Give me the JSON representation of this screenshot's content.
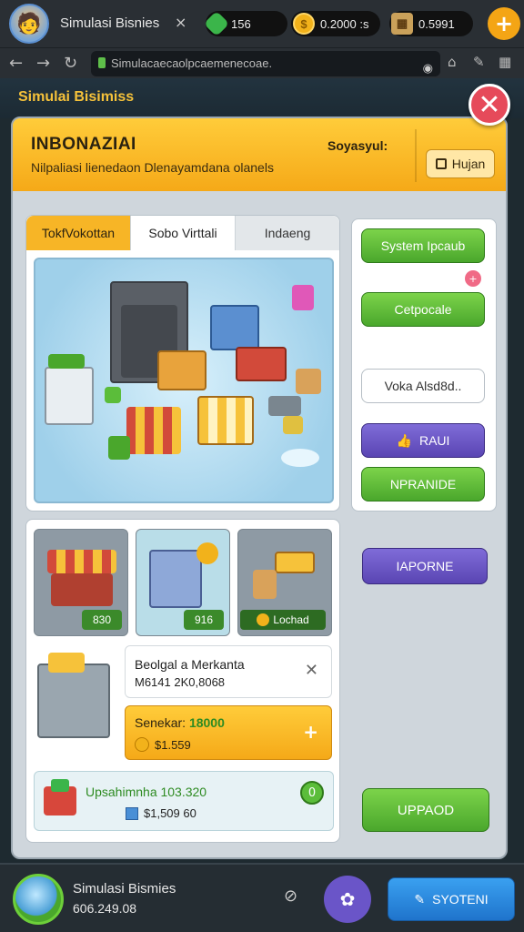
{
  "browser": {
    "tab_title": "Simulasi Bisnies",
    "tab_close": "×",
    "resources": {
      "gems": "156",
      "gold": "0.2000 :s",
      "boxes": "0.5991"
    },
    "add_label": "+",
    "url": "Simulacaecaolpcaemenecoae."
  },
  "game": {
    "title": "Simulai Bisimiss",
    "close_label": "✕"
  },
  "panel": {
    "title": "INBONAZIAI",
    "subtitle": "Nilpaliasi lienedaon Dlenayamdana olanels",
    "right_label": "Soyasyul:",
    "edit_button": "Hujan"
  },
  "tabs": [
    "TokfVokottan",
    "Sobo Virttali",
    "Indaeng"
  ],
  "side_buttons": {
    "system": "System Ipcaub",
    "notif": "+",
    "category": "Cetpocale",
    "field": "Voka Alsd8d..",
    "rau": "RAUI",
    "upgrade_small": "NPRANIDE",
    "import": "IAPORNE",
    "upgrade_big": "UPPAOD"
  },
  "items": {
    "thumb1_price": "830",
    "thumb2_price": "916",
    "thumb3_label": "Lochad",
    "detail_name": "Beolgal a Merkanta",
    "detail_value": "M6141 2K0,8068",
    "buy_prefix": "Senekar:",
    "buy_amount": "18000",
    "buy_cost": "$1.559",
    "upgrade_name": "Upsahimnha 103.320",
    "upgrade_cost": "$1,509 60",
    "upgrade_badge": "0"
  },
  "bottom": {
    "title": "Simulasi Bismies",
    "subtitle": "606.249.08",
    "link_icon": "⊘",
    "action_label": "SYOTENI"
  }
}
